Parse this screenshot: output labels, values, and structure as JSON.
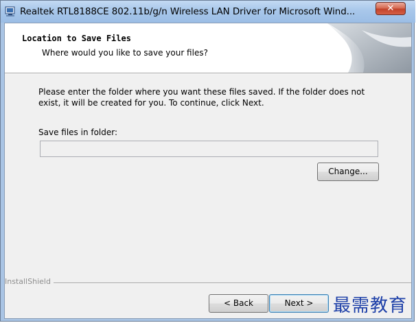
{
  "window": {
    "title": "Realtek RTL8188CE 802.11b/g/n Wireless LAN Driver for Microsoft Wind...",
    "close_label": "✕"
  },
  "header": {
    "title": "Location to Save Files",
    "subtitle": "Where would you like to save your files?"
  },
  "body": {
    "instruction": "Please enter the folder where you want these files saved.  If the folder does not exist, it will be created for you.   To continue, click Next.",
    "folder_label": "Save files in folder:",
    "folder_value": ""
  },
  "buttons": {
    "change": "Change...",
    "back": "< Back",
    "next": "Next >"
  },
  "footer": {
    "brand": "InstallShield"
  },
  "watermark": "最需教育",
  "icons": [
    "app-icon",
    "close-icon",
    "page-curl-graphic"
  ],
  "colors": {
    "title_bar": "#a8c7ea",
    "close_button": "#c2432a",
    "dialog_bg": "#f0f0f0",
    "watermark": "#1d3fa8"
  }
}
